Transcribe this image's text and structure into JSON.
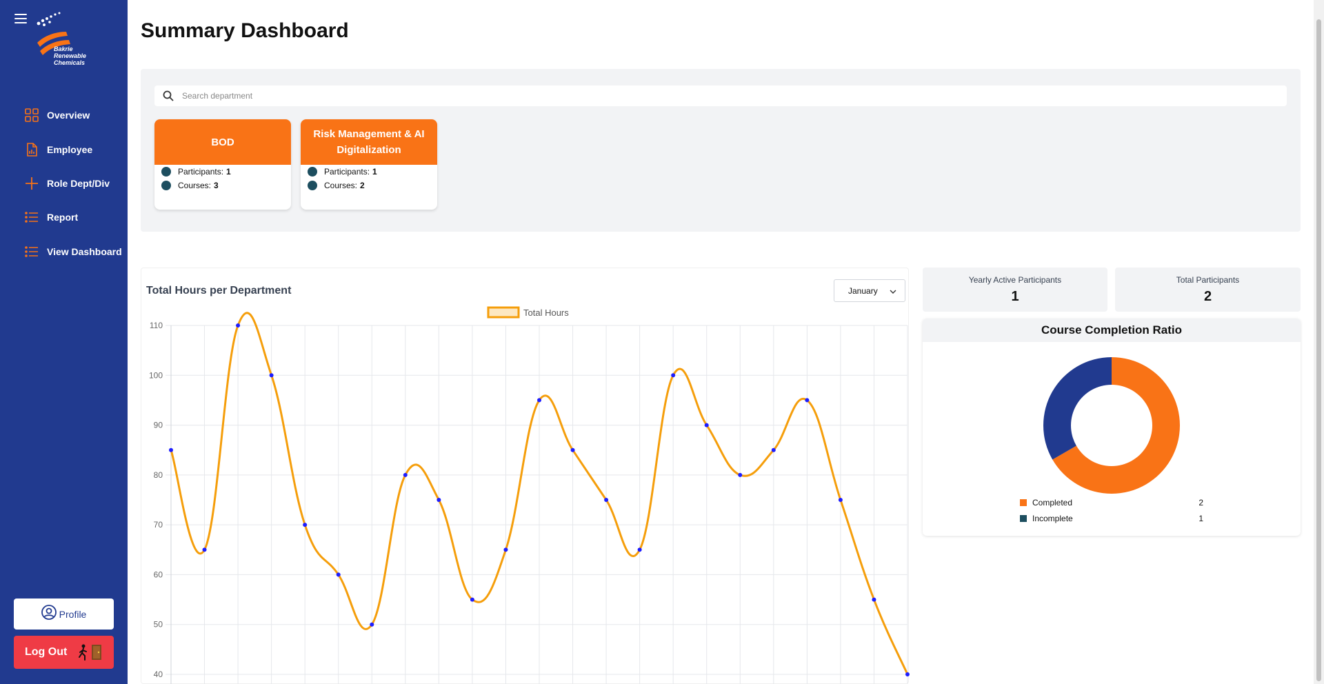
{
  "sidebar": {
    "logo_text": [
      "Bakrie",
      "Renewable",
      "Chemicals"
    ],
    "items": [
      {
        "label": "Overview",
        "icon": "grid-icon"
      },
      {
        "label": "Employee",
        "icon": "document-chart-icon"
      },
      {
        "label": "Role Dept/Div",
        "icon": "plus-icon"
      },
      {
        "label": "Report",
        "icon": "list-icon"
      },
      {
        "label": "View Dashboard",
        "icon": "list-icon"
      }
    ],
    "profile_label": "Profile",
    "logout_label": "Log Out",
    "accent": "#f97316",
    "background": "#213a8f"
  },
  "page": {
    "title": "Summary Dashboard",
    "search_placeholder": "Search department"
  },
  "departments": [
    {
      "name": "BOD",
      "participants_label": "Participants:",
      "participants": "1",
      "courses_label": "Courses:",
      "courses": "3"
    },
    {
      "name": "Risk Management & AI Digitalization",
      "participants_label": "Participants:",
      "participants": "1",
      "courses_label": "Courses:",
      "courses": "2"
    }
  ],
  "hours_chart": {
    "title": "Total Hours per Department",
    "month_selected": "January"
  },
  "stats": {
    "yearly_active_label": "Yearly Active Participants",
    "yearly_active_value": "1",
    "total_participants_label": "Total Participants",
    "total_participants_value": "2"
  },
  "completion": {
    "title": "Course Completion Ratio",
    "legend": [
      {
        "label": "Completed",
        "value": "2",
        "color": "#f97316"
      },
      {
        "label": "Incomplete",
        "value": "1",
        "color": "#1d4e5f"
      }
    ]
  },
  "chart_data": [
    {
      "type": "line",
      "series": [
        {
          "name": "Total Hours",
          "color": "#f59e0b",
          "point_color": "#1d1dff",
          "values": [
            85,
            65,
            110,
            100,
            70,
            60,
            50,
            80,
            75,
            55,
            65,
            95,
            85,
            75,
            65,
            100,
            90,
            80,
            85,
            95,
            75,
            55,
            40
          ]
        }
      ],
      "ylim": [
        40,
        110
      ],
      "yticks": [
        40,
        50,
        60,
        70,
        80,
        90,
        100,
        110
      ],
      "grid": true,
      "legend_position": "top-center"
    },
    {
      "type": "pie",
      "categories": [
        "Completed",
        "Incomplete"
      ],
      "values": [
        2,
        1
      ],
      "colors": [
        "#f97316",
        "#213a8f"
      ],
      "donut": true
    }
  ]
}
